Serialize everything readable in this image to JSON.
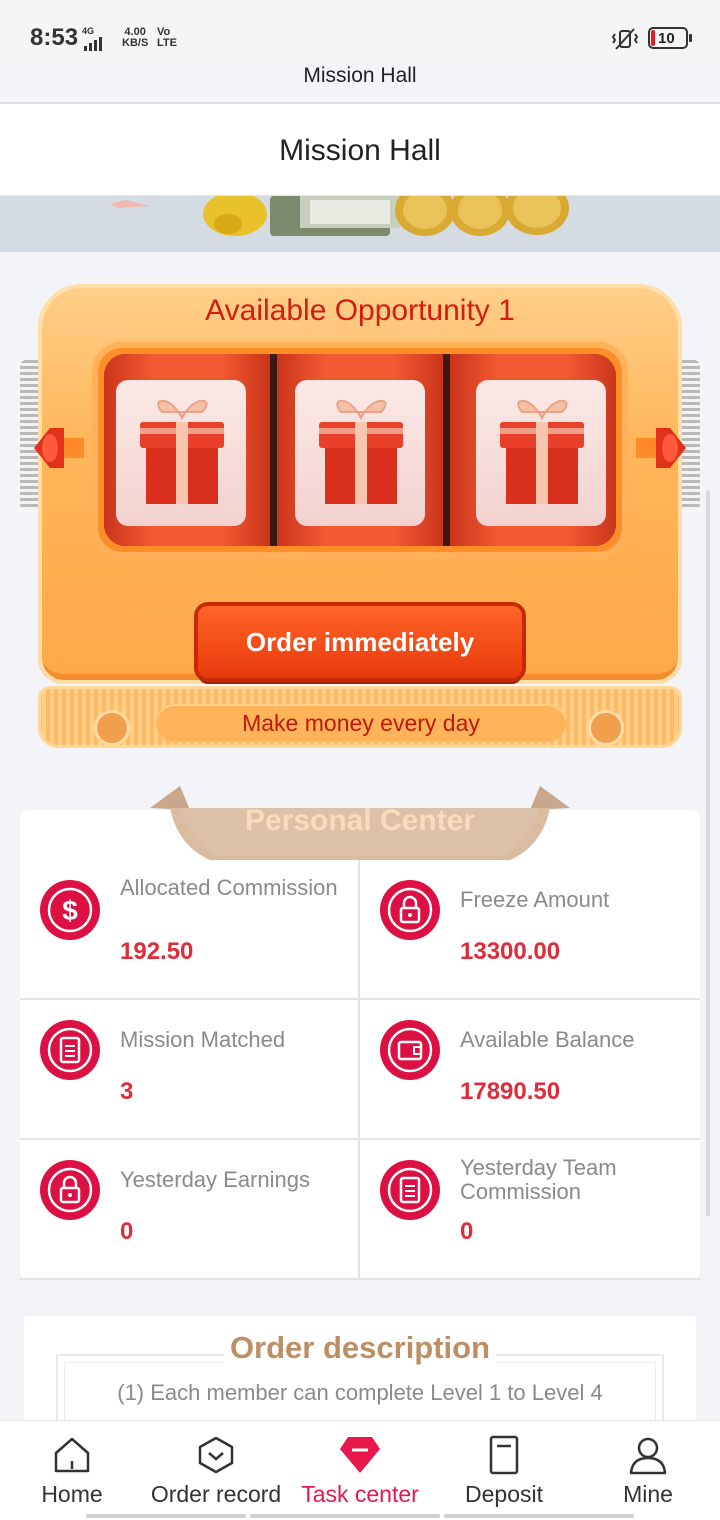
{
  "status_bar": {
    "time": "8:53",
    "network": "4G",
    "speed_value": "4.00",
    "speed_unit": "KB/S",
    "volte_top": "Vo",
    "volte_bottom": "LTE",
    "battery_level": "10"
  },
  "browser": {
    "title": "Mission Hall"
  },
  "header": {
    "title": "Mission Hall"
  },
  "machine": {
    "title": "Available Opportunity 1",
    "button_label": "Order immediately",
    "footer_text": "Make money every day",
    "reel_icons": [
      "gift-icon",
      "gift-icon",
      "gift-icon"
    ]
  },
  "personal_center": {
    "title": "Personal Center",
    "stats": [
      {
        "label": "Allocated Commission",
        "value": "192.50",
        "icon": "dollar-icon"
      },
      {
        "label": "Freeze Amount",
        "value": "13300.00",
        "icon": "lock-icon"
      },
      {
        "label": "Mission Matched",
        "value": "3",
        "icon": "clipboard-icon"
      },
      {
        "label": "Available Balance",
        "value": "17890.50",
        "icon": "wallet-icon"
      },
      {
        "label": "Yesterday Earnings",
        "value": "0",
        "icon": "lock-icon"
      },
      {
        "label": "Yesterday Team Commission",
        "value": "0",
        "icon": "clipboard-icon"
      }
    ]
  },
  "order_description": {
    "title": "Order description",
    "text": "(1) Each member can complete Level 1 to Level 4"
  },
  "tabbar": {
    "items": [
      {
        "label": "Home",
        "icon": "home-icon"
      },
      {
        "label": "Order record",
        "icon": "order-record-icon"
      },
      {
        "label": "Task center",
        "icon": "task-center-icon",
        "active": true
      },
      {
        "label": "Deposit",
        "icon": "deposit-icon"
      },
      {
        "label": "Mine",
        "icon": "user-icon"
      }
    ]
  },
  "colors": {
    "accent_red": "#e02c3a",
    "active_tab": "#e8174c",
    "icon_circle": "#dc1042",
    "machine_orange": "#ffb65a",
    "button_orange": "#e83a0c",
    "desc_title": "#bd8e64"
  }
}
